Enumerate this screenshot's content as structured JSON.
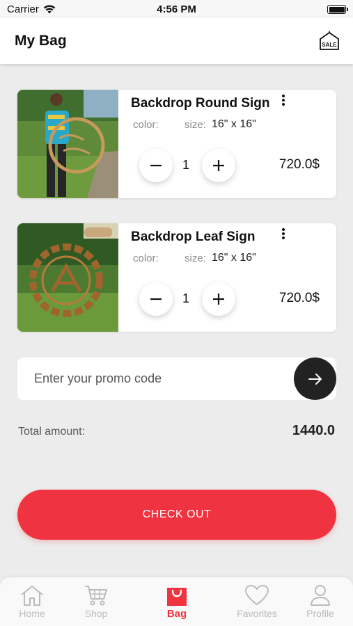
{
  "status_bar": {
    "carrier": "Carrier",
    "time": "4:56 PM"
  },
  "header": {
    "title": "My Bag",
    "sale_icon_text": "SALE"
  },
  "items": [
    {
      "name": "Backdrop Round Sign",
      "color_label": "color:",
      "size_label": "size:",
      "size_value": "16\" x 16\"",
      "quantity": "1",
      "price": "720.0$"
    },
    {
      "name": "Backdrop Leaf Sign",
      "color_label": "color:",
      "size_label": "size:",
      "size_value": "16\" x 16\"",
      "quantity": "1",
      "price": "720.0$"
    }
  ],
  "promo": {
    "placeholder": "Enter your promo code"
  },
  "total": {
    "label": "Total amount:",
    "value": "1440.0"
  },
  "checkout": {
    "label": "CHECK OUT"
  },
  "tabs": [
    {
      "label": "Home",
      "icon": "home-icon"
    },
    {
      "label": "Shop",
      "icon": "cart-icon"
    },
    {
      "label": "Bag",
      "icon": "bag-icon",
      "active": true
    },
    {
      "label": "Favorites",
      "icon": "heart-icon"
    },
    {
      "label": "Profile",
      "icon": "profile-icon"
    }
  ],
  "colors": {
    "accent": "#ef3340",
    "dark": "#222222",
    "background": "#ececec"
  }
}
